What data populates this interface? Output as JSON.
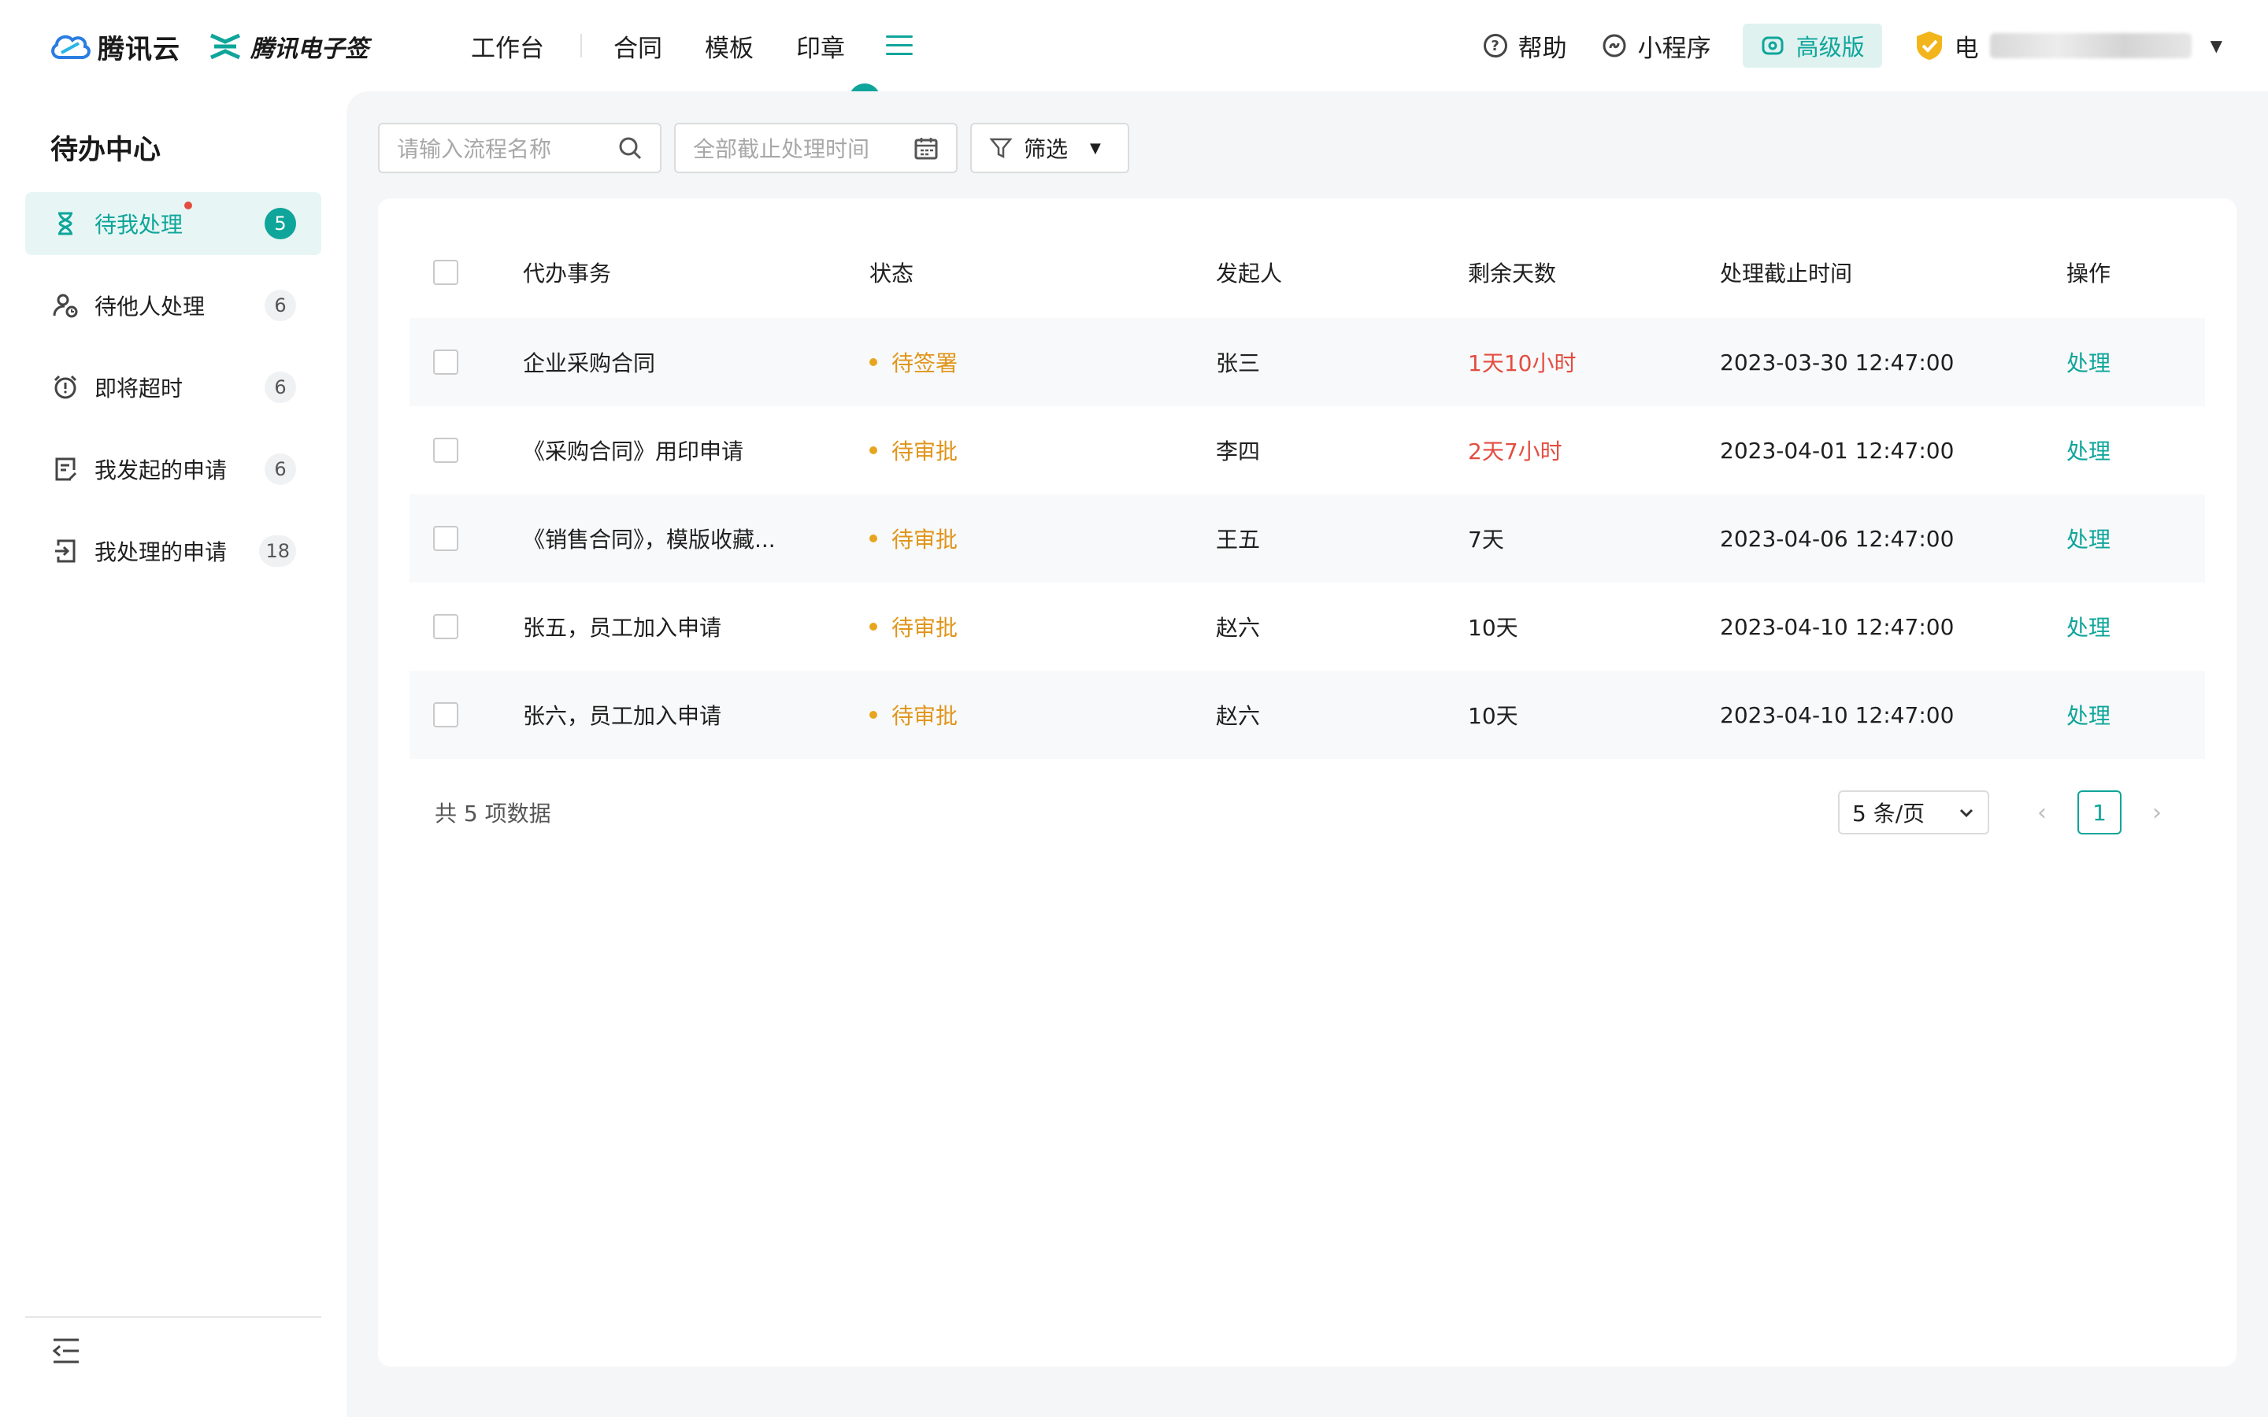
{
  "header": {
    "cloud_logo": "腾讯云",
    "esign_logo": "腾讯电子签",
    "nav": [
      "工作台",
      "合同",
      "模板",
      "印章"
    ],
    "menu_icon": "hamburger-menu-icon",
    "help": "帮助",
    "miniprogram": "小程序",
    "plan_badge": "高级版",
    "company_prefix": "电",
    "accent_color": "#0fa59a"
  },
  "sidebar": {
    "title": "待办中心",
    "items": [
      {
        "label": "待我处理",
        "count": "5",
        "icon": "hourglass-icon"
      },
      {
        "label": "待他人处理",
        "count": "6",
        "icon": "user-clock-icon"
      },
      {
        "label": "即将超时",
        "count": "6",
        "icon": "alarm-clock-icon"
      },
      {
        "label": "我发起的申请",
        "count": "6",
        "icon": "document-edit-icon"
      },
      {
        "label": "我处理的申请",
        "count": "18",
        "icon": "document-enter-icon"
      }
    ]
  },
  "toolbar": {
    "search_placeholder": "请输入流程名称",
    "date_placeholder": "全部截止处理时间",
    "filter_label": "筛选"
  },
  "table": {
    "columns": [
      "代办事务",
      "状态",
      "发起人",
      "剩余天数",
      "处理截止时间",
      "操作"
    ],
    "rows": [
      {
        "title": "企业采购合同",
        "status": "待签署",
        "initiator": "张三",
        "remaining": "1天10小时",
        "deadline": "2023-03-30 12:47:00",
        "action": "处理",
        "urgent": true
      },
      {
        "title": "《采购合同》用印申请",
        "status": "待审批",
        "initiator": "李四",
        "remaining": "2天7小时",
        "deadline": "2023-04-01 12:47:00",
        "action": "处理",
        "urgent": true
      },
      {
        "title": "《销售合同》，模版收藏...",
        "status": "待审批",
        "initiator": "王五",
        "remaining": "7天",
        "deadline": "2023-04-06 12:47:00",
        "action": "处理",
        "urgent": false
      },
      {
        "title": "张五，员工加入申请",
        "status": "待审批",
        "initiator": "赵六",
        "remaining": "10天",
        "deadline": "2023-04-10 12:47:00",
        "action": "处理",
        "urgent": false
      },
      {
        "title": "张六，员工加入申请",
        "status": "待审批",
        "initiator": "赵六",
        "remaining": "10天",
        "deadline": "2023-04-10 12:47:00",
        "action": "处理",
        "urgent": false
      }
    ]
  },
  "pagination": {
    "total_text": "共 5 项数据",
    "page_size": "5 条/页",
    "current_page": "1"
  }
}
